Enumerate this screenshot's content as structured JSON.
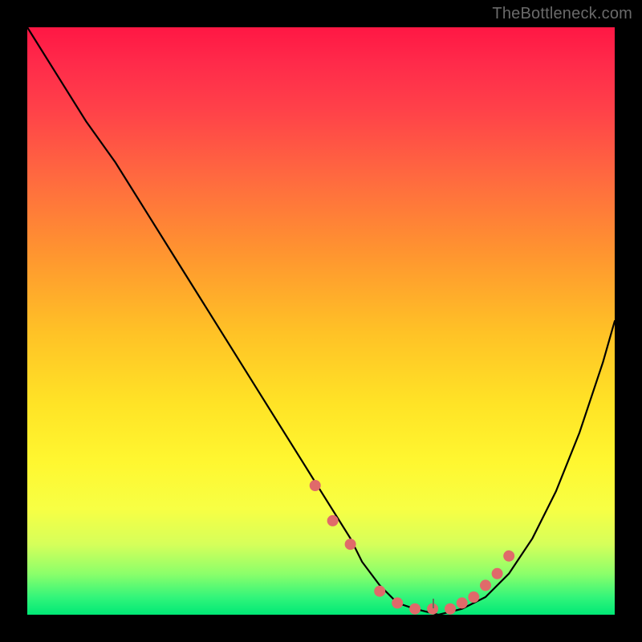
{
  "watermark": {
    "text": "TheBottleneck.com"
  },
  "chart_data": {
    "type": "line",
    "title": "",
    "xlabel": "",
    "ylabel": "",
    "xlim": [
      0,
      100
    ],
    "ylim": [
      0,
      100
    ],
    "grid": false,
    "legend": false,
    "series": [
      {
        "name": "bottleneck-curve",
        "x": [
          0,
          5,
          10,
          15,
          20,
          25,
          30,
          35,
          40,
          45,
          50,
          55,
          57,
          60,
          63,
          66,
          70,
          74,
          78,
          82,
          86,
          90,
          94,
          98,
          100
        ],
        "values": [
          100,
          92,
          84,
          77,
          69,
          61,
          53,
          45,
          37,
          29,
          21,
          13,
          9,
          5,
          2,
          1,
          0,
          1,
          3,
          7,
          13,
          21,
          31,
          43,
          50
        ]
      }
    ],
    "markers": {
      "name": "highlight-dots",
      "color": "#e06a6a",
      "x": [
        49,
        52,
        55,
        60,
        63,
        66,
        69,
        72,
        74,
        76,
        78,
        80,
        82
      ],
      "values": [
        22,
        16,
        12,
        4,
        2,
        1,
        1,
        1,
        2,
        3,
        5,
        7,
        10
      ]
    },
    "background_gradient": {
      "top": "#ff1744",
      "mid": "#ffe326",
      "bottom": "#00e876"
    }
  }
}
